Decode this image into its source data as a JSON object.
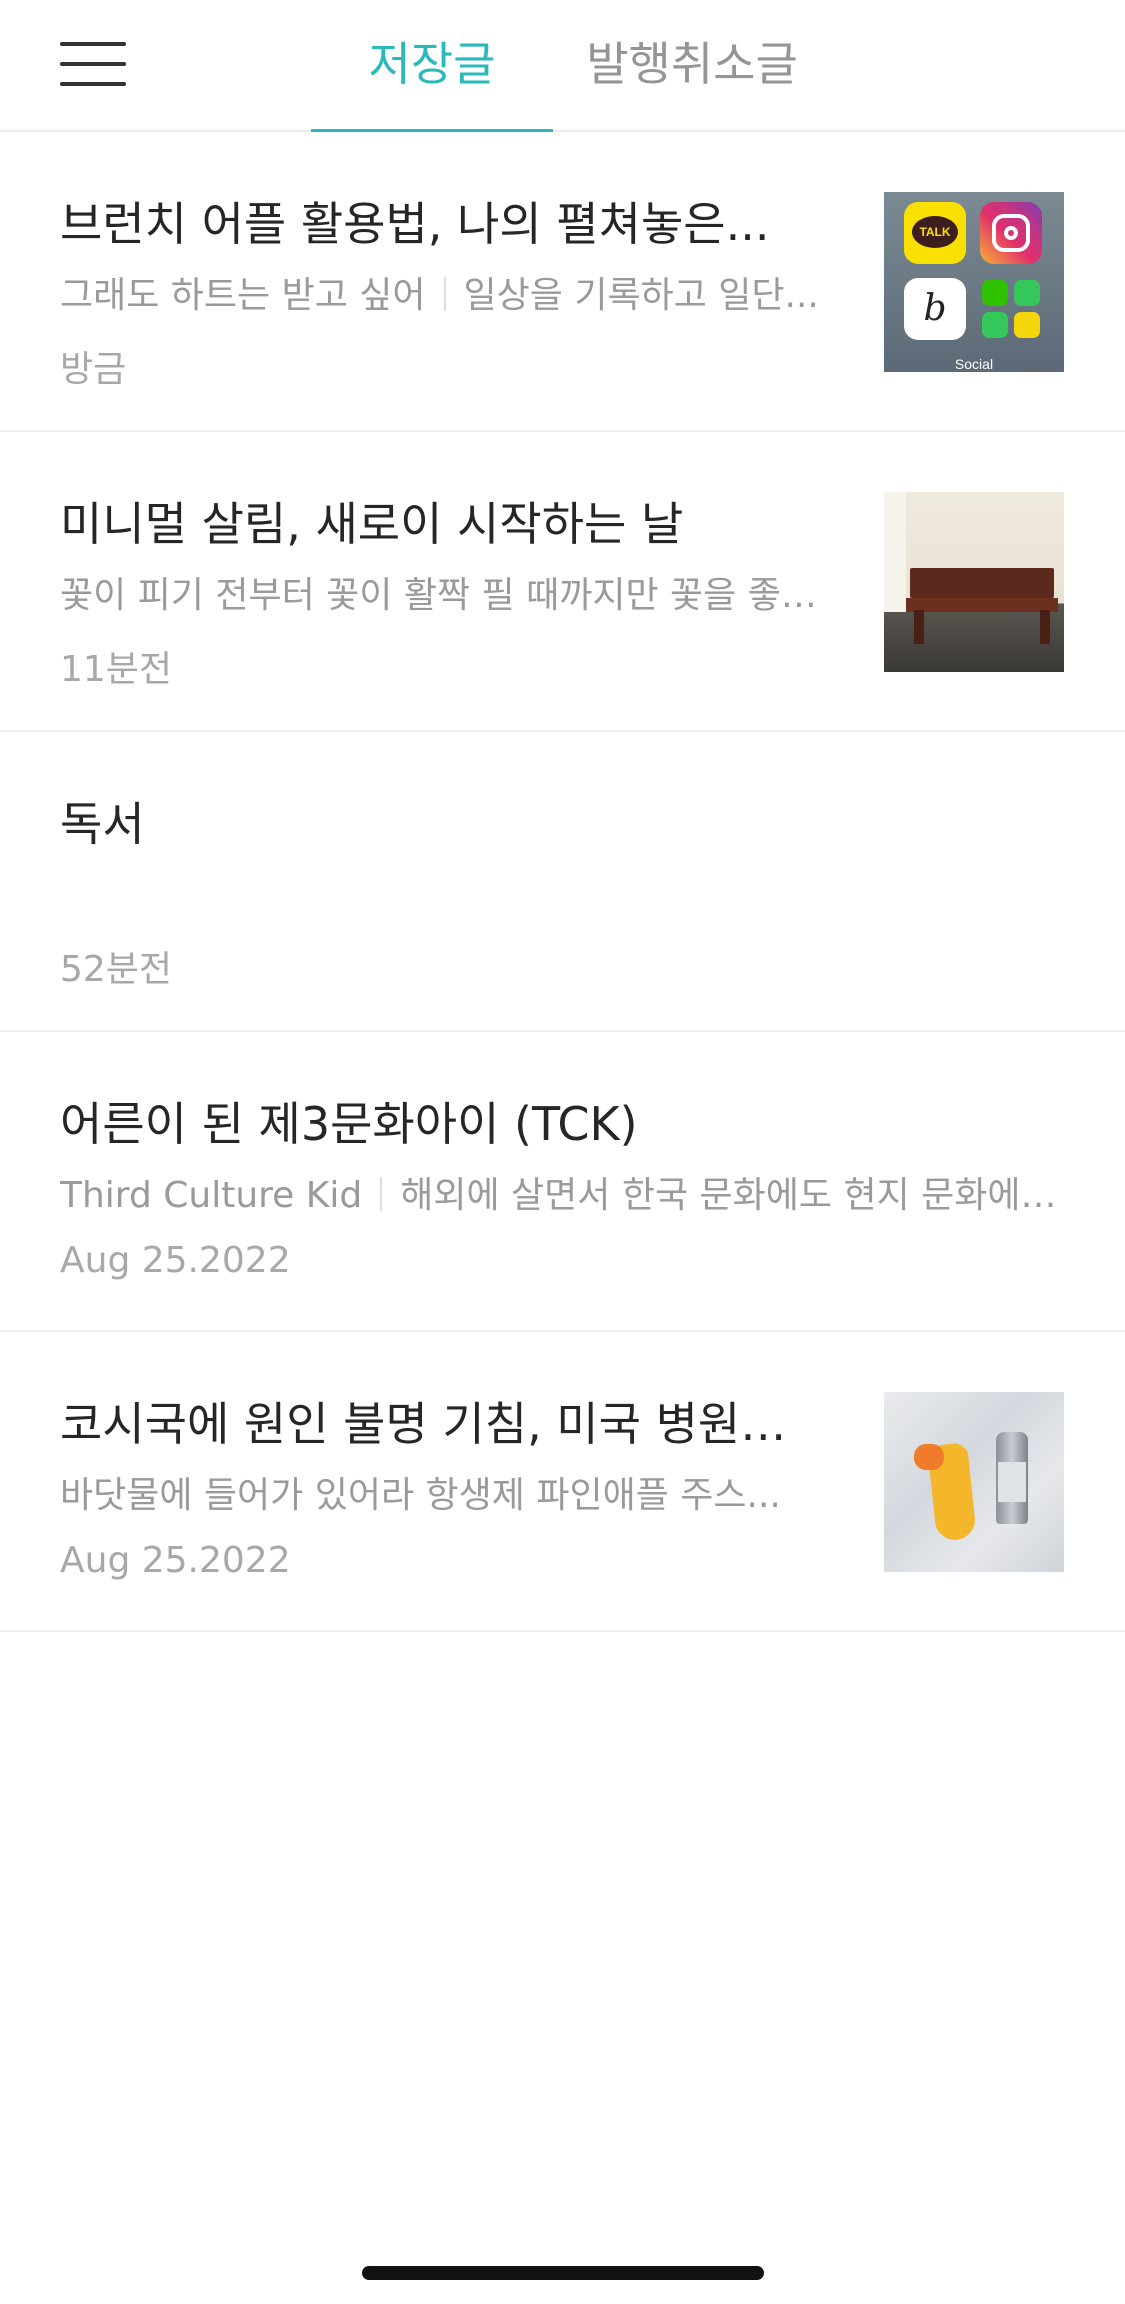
{
  "header": {
    "menu_icon": "hamburger-menu-icon",
    "tabs": [
      {
        "label": "저장글",
        "active": true
      },
      {
        "label": "발행취소글",
        "active": false
      }
    ],
    "accent_color": "#2bb9b9"
  },
  "items": [
    {
      "title": "브런치 어플 활용법, 나의 펼쳐놓은...",
      "subtitle": "그래도 하트는 받고 싶어",
      "excerpt": "일상을 기록하고 일단...",
      "time": "방금",
      "thumbnail": "app-folder-thumbnail",
      "thumbnail_label": "Social"
    },
    {
      "title": "미니멀 살림, 새로이 시작하는 날",
      "subtitle": "",
      "excerpt": "꽃이 피기 전부터 꽃이 활짝 필 때까지만 꽃을 좋…",
      "time": "11분전",
      "thumbnail": "bench-photo-thumbnail"
    },
    {
      "title": "독서",
      "subtitle": "",
      "excerpt": "",
      "time": "52분전"
    },
    {
      "title": "어른이 된 제3문화아이 (TCK)",
      "subtitle": "Third Culture Kid",
      "excerpt": "해외에 살면서 한국 문화에도 현지 문화에…",
      "time": "Aug 25.2022"
    },
    {
      "title": "코시국에 원인 불명 기침, 미국 병원…",
      "subtitle": "",
      "excerpt": "바닷물에 들어가 있어라 항생제 파인애플 주스...",
      "time": "Aug 25.2022",
      "thumbnail": "inhaler-photo-thumbnail"
    }
  ]
}
